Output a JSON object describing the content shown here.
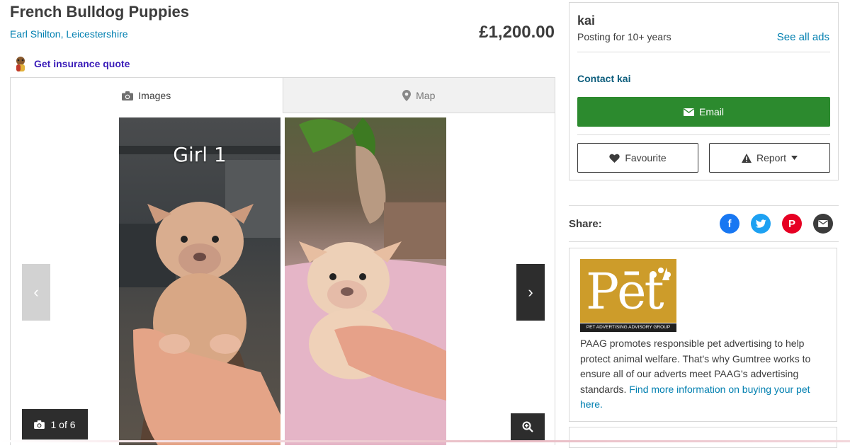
{
  "listing": {
    "title": "French Bulldog Puppies",
    "location": "Earl Shilton, Leicestershire",
    "price": "£1,200.00",
    "insurance_label": "Get insurance quote"
  },
  "gallery": {
    "tabs": [
      {
        "label": "Images",
        "icon": "camera-icon",
        "active": true
      },
      {
        "label": "Map",
        "icon": "map-pin-icon",
        "active": false
      }
    ],
    "photo_caption": "Girl 1",
    "counter": "1 of 6",
    "prev_glyph": "‹",
    "next_glyph": "›"
  },
  "seller": {
    "name": "kai",
    "since": "Posting for 10+ years",
    "see_all": "See all ads",
    "contact": "Contact kai",
    "email_label": "Email",
    "favourite_label": "Favourite",
    "report_label": "Report"
  },
  "share": {
    "label": "Share:",
    "icons": [
      {
        "name": "facebook-icon",
        "glyph": "f",
        "color": "#1877f2"
      },
      {
        "name": "twitter-icon",
        "glyph": "t",
        "color": "#1da1f2"
      },
      {
        "name": "pinterest-icon",
        "glyph": "P",
        "color": "#e60023"
      },
      {
        "name": "email-share-icon",
        "glyph": "✉",
        "color": "#3c3c3c"
      }
    ]
  },
  "paag": {
    "logo_word": "Pēt",
    "logo_group": "PET ADVERTISING ADVISORY GROUP",
    "text": "PAAG promotes responsible pet advertising to help protect animal welfare. That's why Gumtree works to ensure all of our adverts meet PAAG's advertising standards.",
    "link": "Find more information on buying your pet here."
  },
  "colors": {
    "brand_blue": "#007fb0",
    "email_green": "#2c8a2e",
    "insurance_purple": "#3a1cb8",
    "paag_gold": "#cd9c2a"
  }
}
